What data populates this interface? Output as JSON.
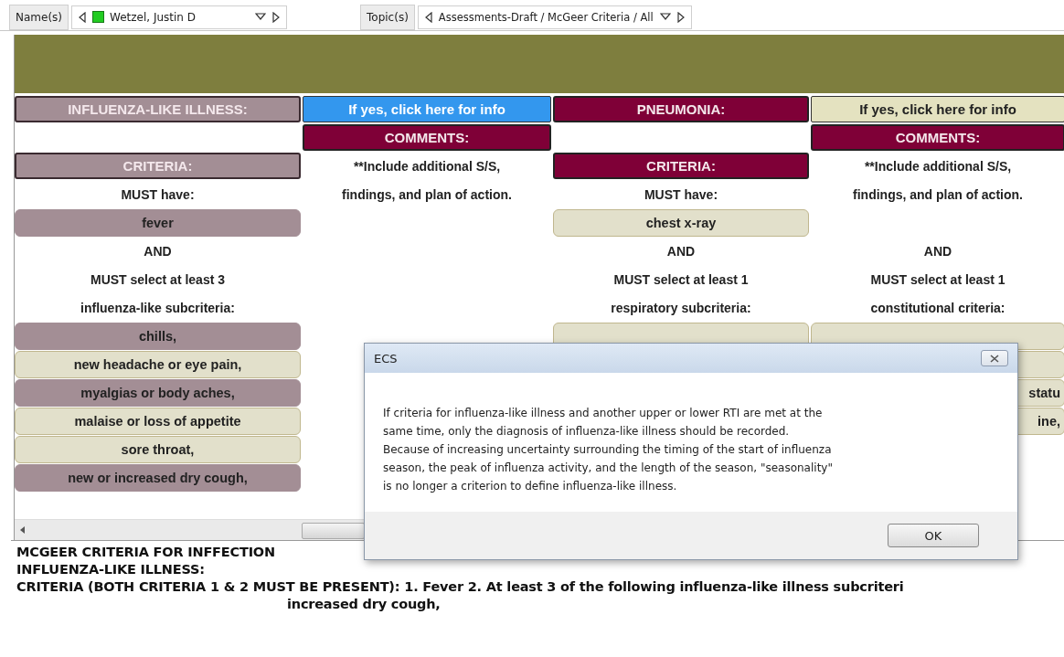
{
  "toolbar": {
    "name_label": "Name(s)",
    "name_value": "Wetzel, Justin D",
    "topic_label": "Topic(s)",
    "topic_value": "Assessments-Draft / McGeer Criteria / All"
  },
  "columns": [
    {
      "items": [
        {
          "kind": "header",
          "highlighted": true,
          "text": "INFLUENZA-LIKE ILLNESS:"
        },
        {
          "kind": "blank"
        },
        {
          "kind": "header",
          "highlighted": true,
          "text": "CRITERIA:"
        },
        {
          "kind": "label",
          "text": "MUST have:"
        },
        {
          "kind": "option",
          "selected": true,
          "text": "fever"
        },
        {
          "kind": "label",
          "text": "AND"
        },
        {
          "kind": "label",
          "text": "MUST select at least 3"
        },
        {
          "kind": "label",
          "text": "influenza-like subcriteria:"
        },
        {
          "kind": "option",
          "selected": true,
          "text": "chills,"
        },
        {
          "kind": "option",
          "selected": false,
          "text": "new headache or eye pain,"
        },
        {
          "kind": "option",
          "selected": true,
          "text": "myalgias or body aches,"
        },
        {
          "kind": "option",
          "selected": false,
          "text": "malaise or loss of appetite"
        },
        {
          "kind": "option",
          "selected": false,
          "text": "sore throat,"
        },
        {
          "kind": "option",
          "selected": true,
          "text": "new or increased dry cough,"
        }
      ]
    },
    {
      "items": [
        {
          "kind": "link",
          "highlighted": true,
          "text": "If yes, click here for info"
        },
        {
          "kind": "header",
          "highlighted": false,
          "text": "COMMENTS:"
        },
        {
          "kind": "label",
          "text": "**Include additional S/S,"
        },
        {
          "kind": "label",
          "text": "findings, and plan of action."
        }
      ]
    },
    {
      "items": [
        {
          "kind": "header",
          "highlighted": false,
          "text": "PNEUMONIA:"
        },
        {
          "kind": "blank"
        },
        {
          "kind": "header",
          "highlighted": false,
          "text": "CRITERIA:"
        },
        {
          "kind": "label",
          "text": "MUST have:"
        },
        {
          "kind": "option",
          "selected": false,
          "text": "chest x-ray"
        },
        {
          "kind": "label",
          "text": "AND"
        },
        {
          "kind": "label",
          "text": "MUST select at least 1"
        },
        {
          "kind": "label",
          "text": "respiratory subcriteria:"
        },
        {
          "kind": "option",
          "selected": false
        }
      ]
    },
    {
      "items": [
        {
          "kind": "link",
          "highlighted": false,
          "text": "If yes, click here for info"
        },
        {
          "kind": "header",
          "highlighted": false,
          "text": "COMMENTS:"
        },
        {
          "kind": "label",
          "text": "**Include additional S/S,"
        },
        {
          "kind": "label",
          "text": "findings, and plan of action."
        },
        {
          "kind": "blank"
        },
        {
          "kind": "label",
          "text": "AND"
        },
        {
          "kind": "label",
          "text": "MUST select at least 1"
        },
        {
          "kind": "label",
          "text": "constitutional criteria:"
        },
        {
          "kind": "option",
          "selected": false
        },
        {
          "kind": "option",
          "selected": false
        },
        {
          "kind": "option",
          "selected": false,
          "text": "statu"
        },
        {
          "kind": "option",
          "selected": false,
          "text": "ine,"
        }
      ]
    }
  ],
  "notes": {
    "lines": [
      "MCGEER CRITERIA FOR INFFECTION",
      "INFLUENZA-LIKE ILLNESS:",
      "CRITERIA (BOTH CRITERIA 1 & 2 MUST BE PRESENT):  1. Fever 2. At least 3 of the following influenza-like illness subcriteri"
    ],
    "continuation": "increased dry cough,"
  },
  "dialog": {
    "title": "ECS",
    "message_lines": [
      "If criteria for influenza-like illness and another upper or lower RTI are met at the",
      "same time, only the diagnosis of influenza-like illness should be recorded.",
      "Because of increasing uncertainty surrounding the timing of the start of influenza",
      "season, the peak of influenza activity, and the length of the season, \"seasonality\"",
      "is no longer a criterion to define influenza-like illness."
    ],
    "button": "OK"
  }
}
